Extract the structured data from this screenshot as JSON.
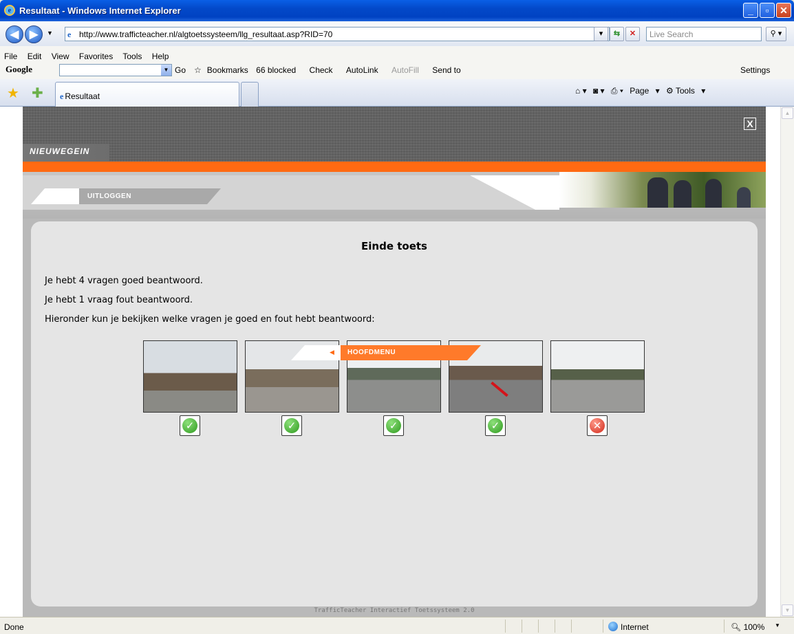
{
  "window": {
    "title": "Resultaat - Windows Internet Explorer"
  },
  "address": {
    "url": "http://www.trafficteacher.nl/algtoetssysteem/llg_resultaat.asp?RID=70",
    "search_placeholder": "Live Search"
  },
  "menu": [
    "File",
    "Edit",
    "View",
    "Favorites",
    "Tools",
    "Help"
  ],
  "google_toolbar": {
    "logo": "Google",
    "go": "Go",
    "bookmarks": "Bookmarks",
    "blocked": "66 blocked",
    "check": "Check",
    "autolink": "AutoLink",
    "autofill": "AutoFill",
    "sendto": "Send to",
    "settings": "Settings"
  },
  "tab": {
    "label": "Resultaat"
  },
  "command_bar": {
    "page": "Page",
    "tools": "Tools"
  },
  "site": {
    "brand": "NIEUWEGEIN",
    "close": "X",
    "logout": "UITLOGGEN",
    "main_menu": "HOOFDMENU",
    "footer": "TrafficTeacher Interactief Toetssysteem 2.0"
  },
  "result": {
    "title": "Einde toets",
    "line1": "Je hebt 4 vragen goed beantwoord.",
    "line2": "Je hebt 1 vraag fout beantwoord.",
    "line3": "Hieronder kun je bekijken welke vragen je goed en fout hebt beantwoord:",
    "questions": [
      {
        "result": "correct",
        "icon": "check-icon"
      },
      {
        "result": "correct",
        "icon": "check-icon"
      },
      {
        "result": "correct",
        "icon": "check-icon"
      },
      {
        "result": "correct",
        "icon": "check-icon"
      },
      {
        "result": "wrong",
        "icon": "cross-icon"
      }
    ]
  },
  "status": {
    "text": "Done",
    "zone": "Internet",
    "zoom": "100%"
  },
  "colors": {
    "accent": "#ff6a12",
    "panel": "#e5e5e5",
    "frame": "#b9b9b9",
    "titlebar": "#0349c9"
  }
}
